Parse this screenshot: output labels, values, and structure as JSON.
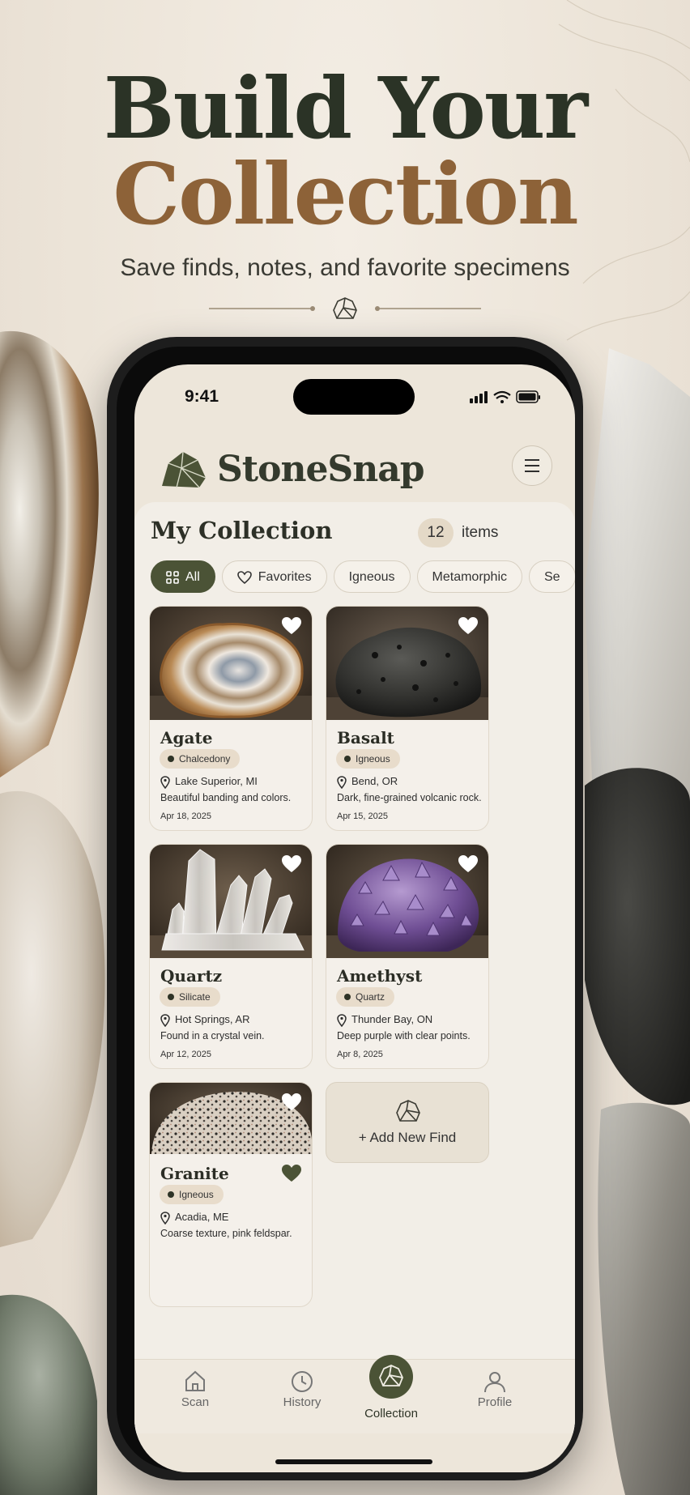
{
  "hero": {
    "line1": "Build Your",
    "line2": "Collection",
    "subtitle": "Save finds, notes, and favorite specimens"
  },
  "status": {
    "time": "9:41"
  },
  "app": {
    "name": "StoneSnap"
  },
  "collection": {
    "title": "My Collection",
    "count": "12",
    "count_label": "items"
  },
  "filters": [
    "All",
    "Favorites",
    "Igneous",
    "Metamorphic",
    "Se"
  ],
  "cards": [
    {
      "name": "Agate",
      "tag": "Chalcedony",
      "location": "Lake Superior, MI",
      "note": "Beautiful banding and colors.",
      "date": "Apr 18, 2025"
    },
    {
      "name": "Basalt",
      "tag": "Igneous",
      "location": "Bend, OR",
      "note": "Dark, fine-grained volcanic rock.",
      "date": "Apr 15, 2025"
    },
    {
      "name": "Quartz",
      "tag": "Silicate",
      "location": "Hot Springs, AR",
      "note": "Found in a crystal vein.",
      "date": "Apr 12, 2025"
    },
    {
      "name": "Amethyst",
      "tag": "Quartz",
      "location": "Thunder Bay, ON",
      "note": "Deep purple with clear points.",
      "date": "Apr 8, 2025"
    },
    {
      "name": "Granite",
      "tag": "Igneous",
      "location": "Acadia, ME",
      "note": "Coarse texture, pink feldspar.",
      "date": ""
    }
  ],
  "add_new": "+ Add New Find",
  "tabs": [
    "Scan",
    "History",
    "Collection",
    "Profile"
  ],
  "colors": {
    "accent": "#4b5336",
    "brand_brown": "#8d6238",
    "dark_green": "#2b3326"
  }
}
